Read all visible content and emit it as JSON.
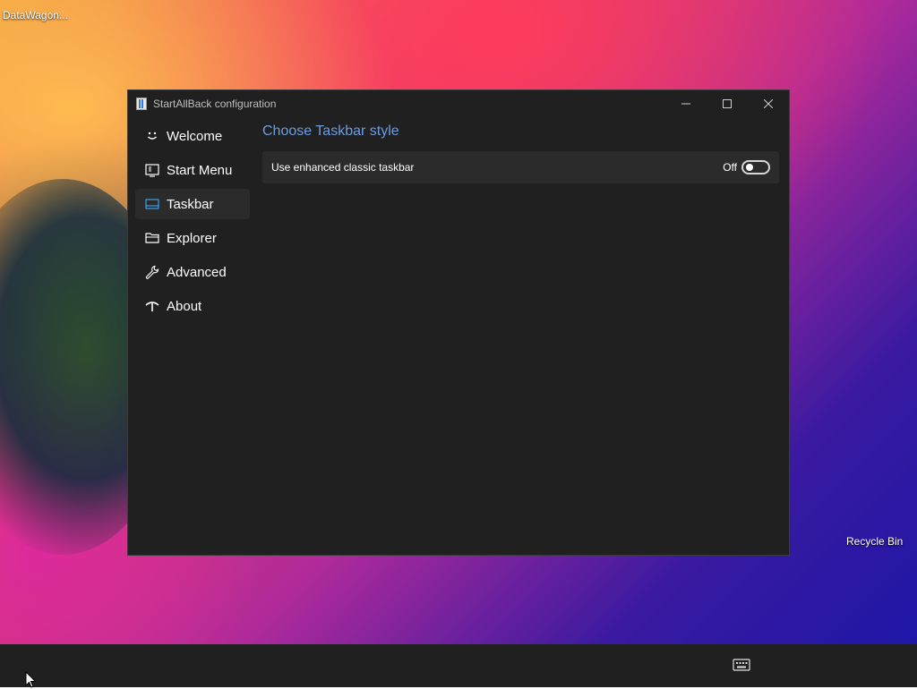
{
  "desktop": {
    "top_left_label": "DataWagon...",
    "recycle_bin_label": "Recycle Bin"
  },
  "window": {
    "title": "StartAllBack configuration",
    "app_icon": "startallback-app-icon",
    "caption_buttons": [
      "minimize-icon",
      "maximize-icon",
      "close-icon"
    ]
  },
  "sidebar": {
    "items": [
      {
        "label": "Welcome",
        "icon": "smiley-icon",
        "selected": false
      },
      {
        "label": "Start Menu",
        "icon": "start-menu-icon",
        "selected": false
      },
      {
        "label": "Taskbar",
        "icon": "taskbar-icon",
        "selected": true
      },
      {
        "label": "Explorer",
        "icon": "folder-icon",
        "selected": false
      },
      {
        "label": "Advanced",
        "icon": "wrench-icon",
        "selected": false
      },
      {
        "label": "About",
        "icon": "about-icon",
        "selected": false
      }
    ]
  },
  "main": {
    "section_title": "Choose Taskbar style",
    "setting": {
      "label": "Use enhanced classic taskbar",
      "state_label": "Off",
      "enabled": false
    }
  },
  "colors": {
    "accent": "#6c9ce0",
    "window_bg": "#202020",
    "row_bg": "#2b2b2b",
    "selected_icon": "#3aa0e8"
  },
  "taskbar": {
    "tray_icon": "keyboard-icon"
  }
}
